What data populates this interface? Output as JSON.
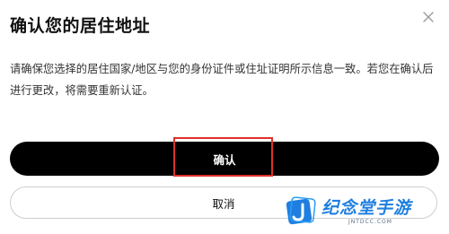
{
  "dialog": {
    "title": "确认您的居住地址",
    "close_icon": "close-icon",
    "message": "请确保您选择的居住国家/地区与您的身份证件或住址证明所示信息一致。若您在确认后进行更改，将需要重新认证。",
    "confirm_label": "确认",
    "cancel_label": "取消",
    "colors": {
      "primary_button": "#000000",
      "primary_text": "#ffffff",
      "highlight_border": "#e0302a",
      "cancel_border": "#cfcfcf"
    }
  },
  "watermark": {
    "name": "纪念堂手游",
    "url": "JNTDCC.COM",
    "color": "#1f7fe0"
  }
}
